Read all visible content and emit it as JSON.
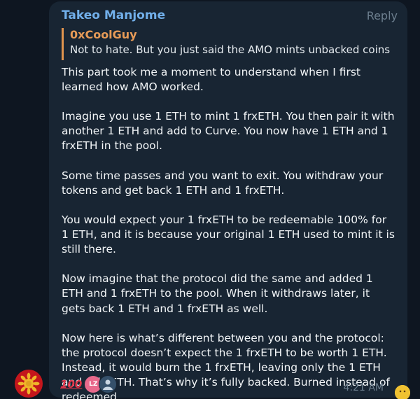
{
  "message": {
    "sender": "Takeo Manjome",
    "reply_label": "Reply",
    "quote": {
      "author": "0xCoolGuy",
      "text": "Not to hate. But you just said the AMO mints unbacked coins. It..."
    },
    "paragraphs": [
      "This part took me a moment to understand when I first learned how AMO worked.",
      "Imagine you use 1 ETH to mint 1 frxETH. You then pair it with another 1 ETH and add to Curve. You now have 1 ETH and 1 frxETH in the pool.",
      "Some time passes and you want to exit. You withdraw your tokens and get back 1 ETH and 1 frxETH.",
      "You would expect your 1 frxETH to be redeemable 100% for 1 ETH, and it is because your original 1 ETH used to mint it is still there.",
      "Now imagine that the protocol did the same and added 1 ETH and 1 frxETH to the pool. When it withdraws later, it gets back 1 ETH and 1 frxETH as well.",
      "Now here is what’s different between you and the protocol: the protocol doesn’t expect the 1 frxETH to be worth 1 ETH. Instead, it would burn the 1 frxETH, leaving only the 1 ETH and 0 frxETH. That’s why it’s fully backed. Burned instead of redeemed."
    ],
    "reactions": {
      "emoji": "100",
      "emoji_name": "hundred-points-icon",
      "reactor_initials": "LZ"
    },
    "timestamp": "4:21 AM"
  },
  "colors": {
    "background": "#0e1621",
    "bubble": "#182533",
    "sender": "#72b0eb",
    "quote_author": "#e79b57",
    "quote_bar": "#e0944e",
    "text": "#f2f5f7",
    "muted": "#6d7f8f"
  }
}
